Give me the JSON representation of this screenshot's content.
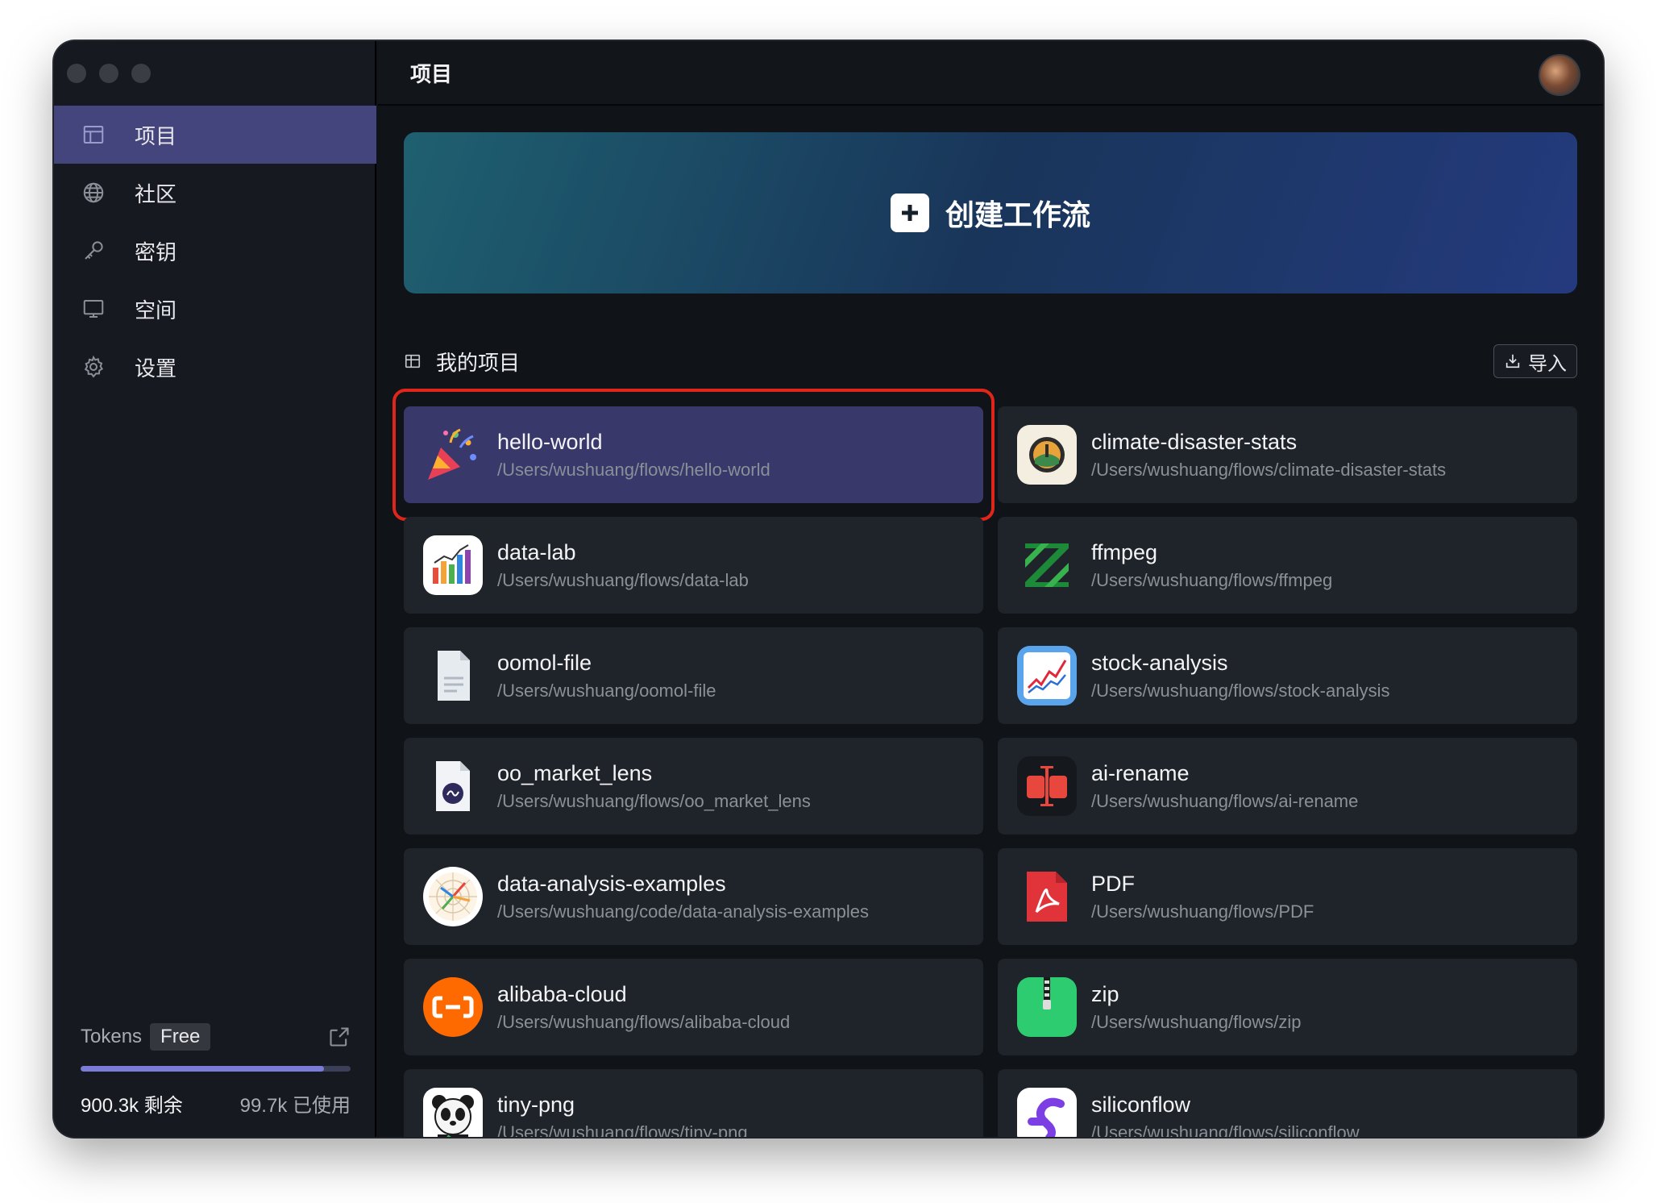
{
  "sidebar": {
    "items": [
      {
        "label": "项目",
        "icon": "table-icon",
        "active": true
      },
      {
        "label": "社区",
        "icon": "globe-icon"
      },
      {
        "label": "密钥",
        "icon": "key-icon"
      },
      {
        "label": "空间",
        "icon": "monitor-icon"
      },
      {
        "label": "设置",
        "icon": "gear-icon"
      }
    ],
    "tokens": {
      "label": "Tokens",
      "plan": "Free",
      "remaining": "900.3k 剩余",
      "used": "99.7k 已使用",
      "usage_fraction": 0.9
    }
  },
  "header": {
    "title": "项目"
  },
  "hero": {
    "label": "创建工作流"
  },
  "section": {
    "title": "我的项目",
    "import_label": "导入"
  },
  "projects": [
    {
      "name": "hello-world",
      "path": "/Users/wushuang/flows/hello-world",
      "icon": "party-popper-icon"
    },
    {
      "name": "climate-disaster-stats",
      "path": "/Users/wushuang/flows/climate-disaster-stats",
      "icon": "globe-badge-icon"
    },
    {
      "name": "data-lab",
      "path": "/Users/wushuang/flows/data-lab",
      "icon": "bar-chart-icon"
    },
    {
      "name": "ffmpeg",
      "path": "/Users/wushuang/flows/ffmpeg",
      "icon": "ffmpeg-icon"
    },
    {
      "name": "oomol-file",
      "path": "/Users/wushuang/oomol-file",
      "icon": "file-icon"
    },
    {
      "name": "stock-analysis",
      "path": "/Users/wushuang/flows/stock-analysis",
      "icon": "line-chart-icon"
    },
    {
      "name": "oo_market_lens",
      "path": "/Users/wushuang/flows/oo_market_lens",
      "icon": "market-lens-icon"
    },
    {
      "name": "ai-rename",
      "path": "/Users/wushuang/flows/ai-rename",
      "icon": "rename-icon"
    },
    {
      "name": "data-analysis-examples",
      "path": "/Users/wushuang/code/data-analysis-examples",
      "icon": "radar-icon"
    },
    {
      "name": "PDF",
      "path": "/Users/wushuang/flows/PDF",
      "icon": "pdf-icon"
    },
    {
      "name": "alibaba-cloud",
      "path": "/Users/wushuang/flows/alibaba-cloud",
      "icon": "alibaba-cloud-icon"
    },
    {
      "name": "zip",
      "path": "/Users/wushuang/flows/zip",
      "icon": "zip-icon"
    },
    {
      "name": "tiny-png",
      "path": "/Users/wushuang/flows/tiny-png",
      "icon": "panda-icon"
    },
    {
      "name": "siliconflow",
      "path": "/Users/wushuang/flows/siliconflow",
      "icon": "siliconflow-icon"
    }
  ],
  "colors": {
    "sidebar_active": "#45457e",
    "selected_card": "#38386a",
    "selection_outline": "#e0261b",
    "progress_fill": "#7b7bd8"
  }
}
